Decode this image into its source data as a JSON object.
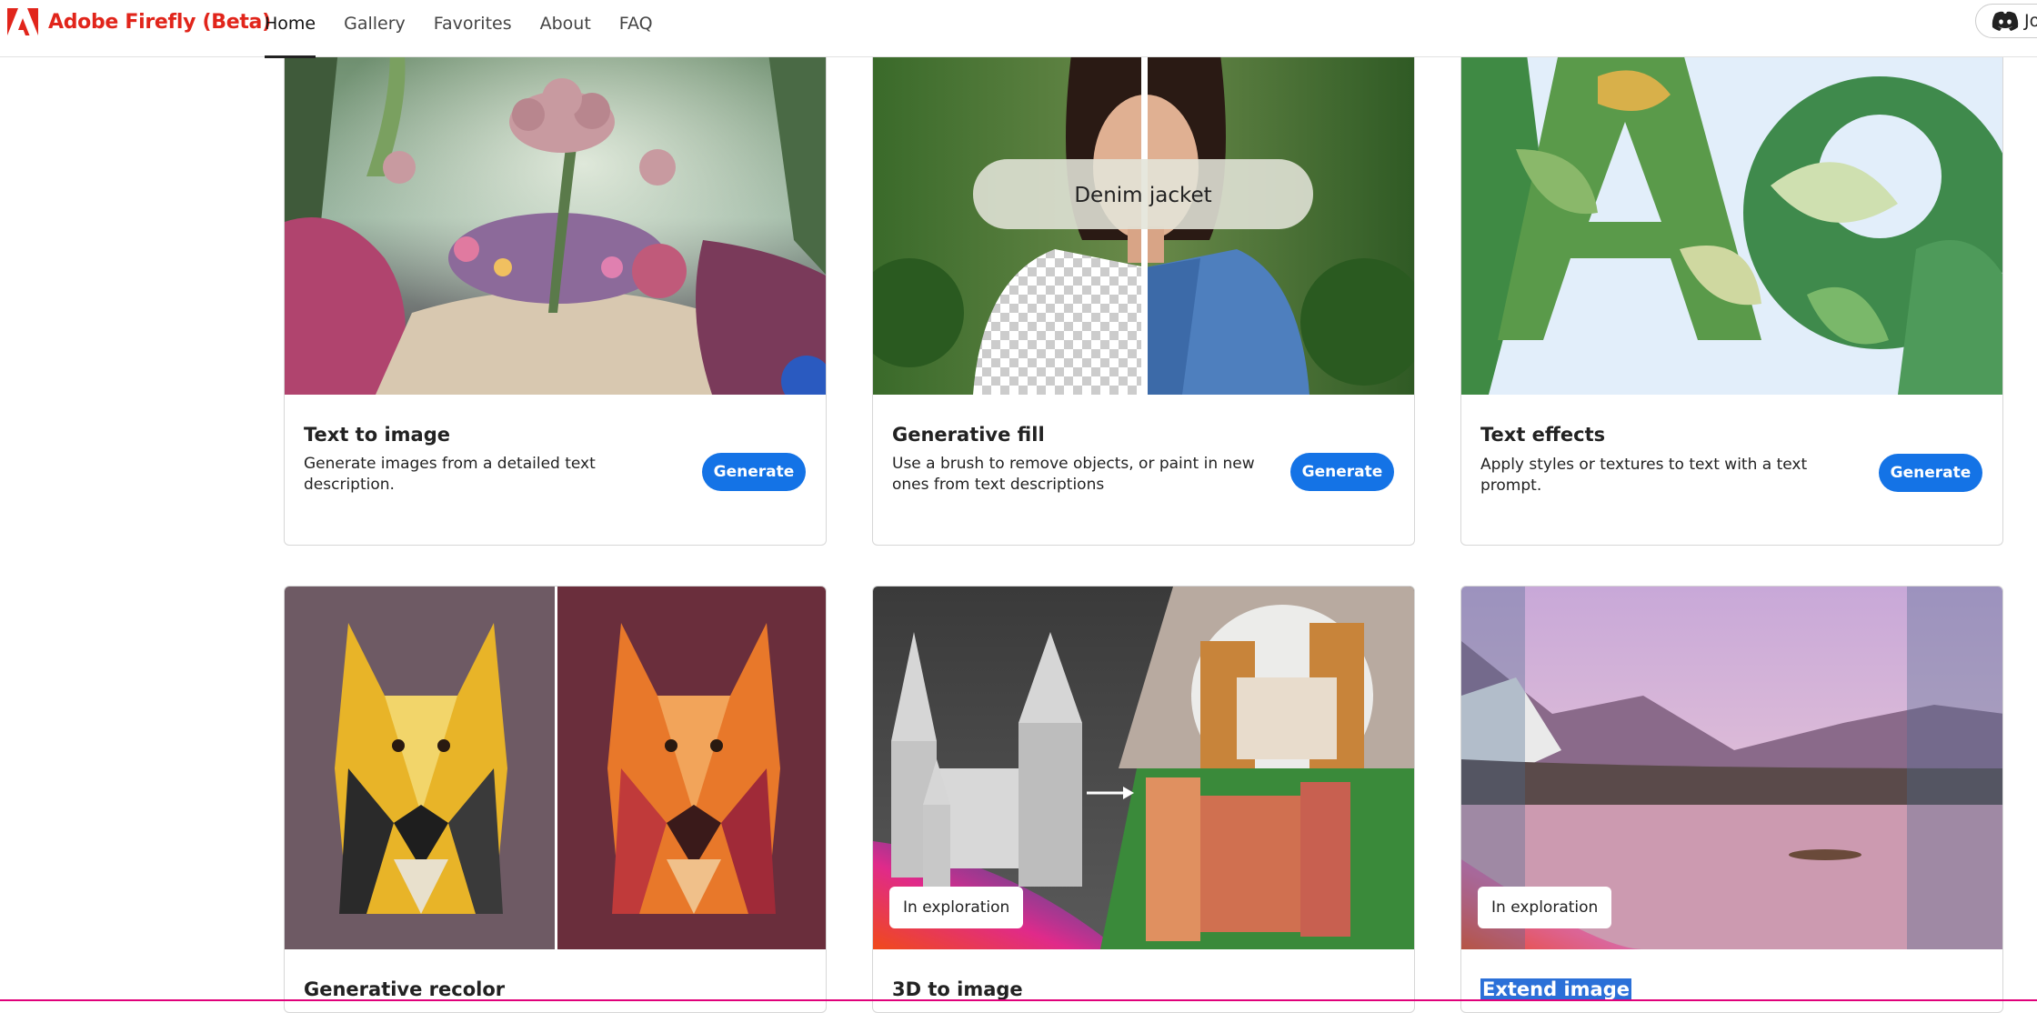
{
  "header": {
    "brand": "Adobe Firefly (Beta)",
    "nav": [
      "Home",
      "Gallery",
      "Favorites",
      "About",
      "FAQ"
    ],
    "active_nav": "Home",
    "discord_label": "Jo"
  },
  "cards": [
    {
      "title": "Text to image",
      "description": "Generate images from a detailed text description.",
      "button": "Generate"
    },
    {
      "title": "Generative fill",
      "description": "Use a brush to remove objects, or paint in new ones from text descriptions",
      "button": "Generate",
      "prompt": "Denim jacket"
    },
    {
      "title": "Text effects",
      "description": "Apply styles or textures to text with a text prompt.",
      "button": "Generate"
    },
    {
      "title": "Generative recolor"
    },
    {
      "title": "3D to image",
      "badge": "In exploration"
    },
    {
      "title": "Extend image",
      "badge": "In exploration"
    }
  ],
  "colors": {
    "brand": "#e1251b",
    "accent": "#1473e6"
  }
}
